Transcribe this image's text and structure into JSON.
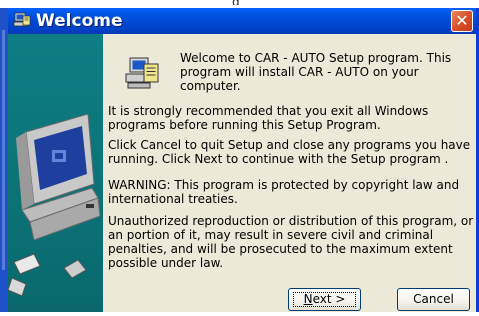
{
  "window": {
    "title": "Welcome",
    "close_glyph": "✕"
  },
  "top_fragment": "g",
  "content": {
    "intro": "Welcome to CAR - AUTO Setup program. This program will install CAR - AUTO on your computer.",
    "para1": "It is strongly recommended that you exit all Windows programs before running this Setup Program.",
    "para2": "Click Cancel to quit Setup and close any programs you have running.  Click Next to continue with the Setup program .",
    "warning": "WARNING: This program is protected by copyright law and international treaties.",
    "para3": "Unauthorized reproduction or distribution of this program, or an portion of it, may result in severe civil and criminal penalties, and will be prosecuted to the maximum extent possible under law."
  },
  "buttons": {
    "next_accel": "N",
    "next_rest": "ext >",
    "cancel": "Cancel"
  },
  "colors": {
    "titlebar": "#0047d0",
    "side_panel": "#0b7276",
    "close": "#d7512b",
    "dialog_bg": "#ece9d8"
  },
  "icons": {
    "title": "setup-computer-icon",
    "header": "setup-computer-icon",
    "close": "close-icon"
  }
}
